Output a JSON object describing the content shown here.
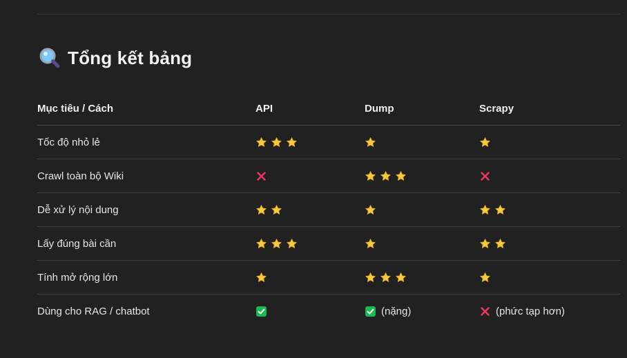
{
  "heading": {
    "title": "Tổng kết bảng",
    "icon": "magnifier-icon"
  },
  "table": {
    "headers": [
      "Mục tiêu / Cách",
      "API",
      "Dump",
      "Scrapy"
    ],
    "rows": [
      {
        "label": "Tốc độ nhỏ lẻ",
        "cells": [
          {
            "type": "stars",
            "count": 3
          },
          {
            "type": "stars",
            "count": 1
          },
          {
            "type": "stars",
            "count": 1
          }
        ]
      },
      {
        "label": "Crawl toàn bộ Wiki",
        "cells": [
          {
            "type": "cross"
          },
          {
            "type": "stars",
            "count": 3
          },
          {
            "type": "cross"
          }
        ]
      },
      {
        "label": "Dễ xử lý nội dung",
        "cells": [
          {
            "type": "stars",
            "count": 2
          },
          {
            "type": "stars",
            "count": 1
          },
          {
            "type": "stars",
            "count": 2
          }
        ]
      },
      {
        "label": "Lấy đúng bài cần",
        "cells": [
          {
            "type": "stars",
            "count": 3
          },
          {
            "type": "stars",
            "count": 1
          },
          {
            "type": "stars",
            "count": 2
          }
        ]
      },
      {
        "label": "Tính mở rộng lớn",
        "cells": [
          {
            "type": "stars",
            "count": 1
          },
          {
            "type": "stars",
            "count": 3
          },
          {
            "type": "stars",
            "count": 1
          }
        ]
      },
      {
        "label": "Dùng cho RAG / chatbot",
        "cells": [
          {
            "type": "check"
          },
          {
            "type": "check",
            "note": "(nặng)"
          },
          {
            "type": "cross",
            "note": "(phức tạp hơn)"
          }
        ]
      }
    ]
  },
  "colors": {
    "background": "#212121",
    "star": "#f7c948",
    "cross": "#e8365d",
    "check": "#1db954",
    "text": "#e6e6e6"
  }
}
